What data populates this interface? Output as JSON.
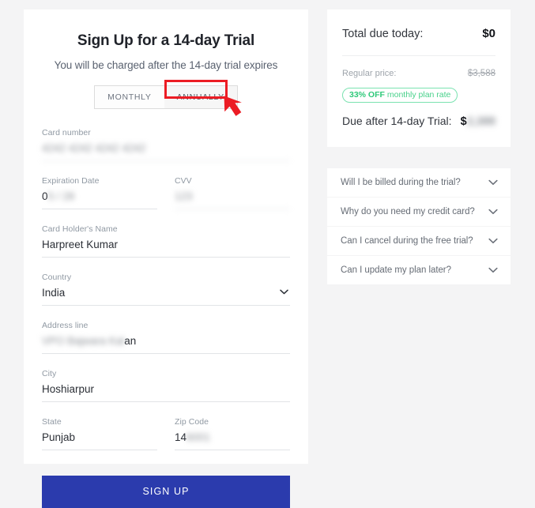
{
  "page": {
    "background_color": "#f4f4f5"
  },
  "signup": {
    "title": "Sign Up for a 14-day Trial",
    "subtitle": "You will be charged after the 14-day trial expires",
    "plan_toggle": {
      "monthly_label": "MONTHLY",
      "annually_label": "ANNUALLY",
      "selected": "ANNUALLY"
    },
    "fields": {
      "card_number": {
        "label": "Card number",
        "value": "4242 4242 4242 4242",
        "redacted": true
      },
      "expiration_date": {
        "label": "Expiration Date",
        "value_visible": "0",
        "value_redacted": "5 / 28",
        "redacted": true
      },
      "cvv": {
        "label": "CVV",
        "value": "123",
        "redacted": true
      },
      "card_holder_name": {
        "label": "Card Holder's Name",
        "value": "Harpreet Kumar",
        "redacted": false
      },
      "country": {
        "label": "Country",
        "value": "India",
        "redacted": false
      },
      "address_line": {
        "label": "Address line",
        "value_redacted": "VPO Bajwara Kal",
        "value_visible": "an",
        "redacted": true
      },
      "city": {
        "label": "City",
        "value": "Hoshiarpur",
        "redacted": false
      },
      "state": {
        "label": "State",
        "value": "Punjab",
        "redacted": false
      },
      "zip_code": {
        "label": "Zip Code",
        "value_visible": "14",
        "value_redacted": "6001",
        "redacted": true
      }
    },
    "submit_label": "SIGN UP",
    "submit_color": "#2b3bad"
  },
  "pricing": {
    "total_due_label": "Total due today:",
    "total_due_value": "$0",
    "regular_price_label": "Regular price:",
    "regular_price_value": "$3,588",
    "discount_badge": {
      "emphasis": "33% OFF",
      "text": " monthly plan rate",
      "color": "#2fc97a"
    },
    "due_after_trial_label": "Due after 14-day Trial:",
    "due_after_trial_currency": "$",
    "due_after_trial_value": "2,388",
    "due_after_trial_redacted": true
  },
  "faq": {
    "items": [
      {
        "question": "Will I be billed during the trial?",
        "icon": "chevron-down-icon"
      },
      {
        "question": "Why do you need my credit card?",
        "icon": "chevron-down-icon"
      },
      {
        "question": "Can I cancel during the free trial?",
        "icon": "chevron-down-icon"
      },
      {
        "question": "Can I update my plan later?",
        "icon": "chevron-down-icon"
      }
    ]
  },
  "annotation": {
    "type": "highlight-box-with-arrow",
    "target": "ANNUALLY",
    "color": "#ec1c24"
  }
}
